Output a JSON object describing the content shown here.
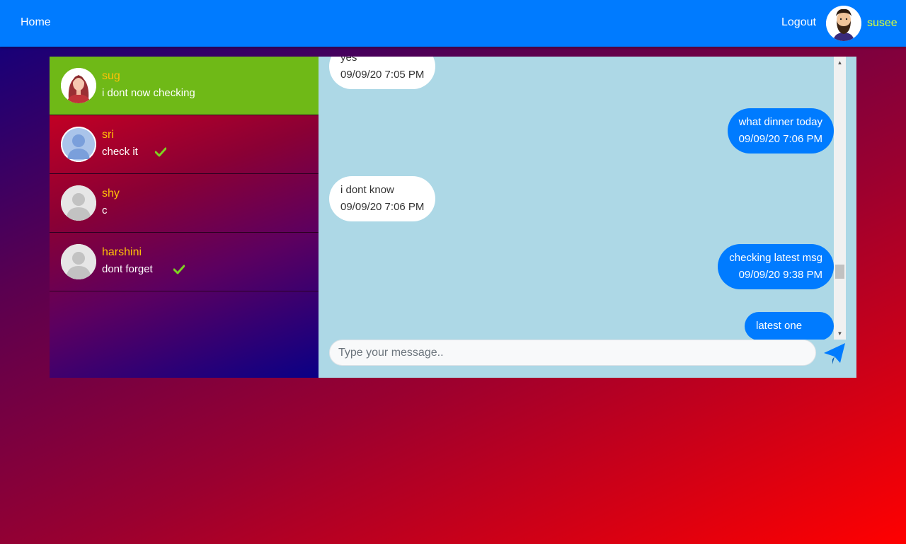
{
  "navbar": {
    "home_label": "Home",
    "logout_label": "Logout",
    "username": "susee",
    "avatar_icon": "bearded-man-avatar-icon"
  },
  "contacts": [
    {
      "name": "sug",
      "preview": "i dont now checking",
      "active": true,
      "read": false,
      "avatar_icon": "woman-avatar-icon"
    },
    {
      "name": "sri",
      "preview": "check it",
      "active": false,
      "read": true,
      "avatar_icon": "blue-person-avatar-icon"
    },
    {
      "name": "shy",
      "preview": "c",
      "active": false,
      "read": false,
      "avatar_icon": "default-avatar-icon"
    },
    {
      "name": "harshini",
      "preview": "dont forget",
      "active": false,
      "read": true,
      "avatar_icon": "default-avatar-icon"
    }
  ],
  "messages": [
    {
      "direction": "in",
      "text": "yes",
      "time": "09/09/20 7:05 PM"
    },
    {
      "direction": "out",
      "text": "what dinner today",
      "time": "09/09/20 7:06 PM"
    },
    {
      "direction": "in",
      "text": "i dont know",
      "time": "09/09/20 7:06 PM"
    },
    {
      "direction": "out",
      "text": "checking latest msg",
      "time": "09/09/20 9:38 PM"
    },
    {
      "direction": "out",
      "text": "latest one",
      "time": ""
    }
  ],
  "composer": {
    "placeholder": "Type your message..",
    "value": ""
  },
  "colors": {
    "navbar": "#007bff",
    "active_contact": "#6fb917",
    "contact_name": "#ffc107",
    "username": "#d7ff3a",
    "chat_background": "#add8e6",
    "outgoing_bubble": "#007bff",
    "incoming_bubble": "#ffffff",
    "read_check": "#7ed321"
  }
}
